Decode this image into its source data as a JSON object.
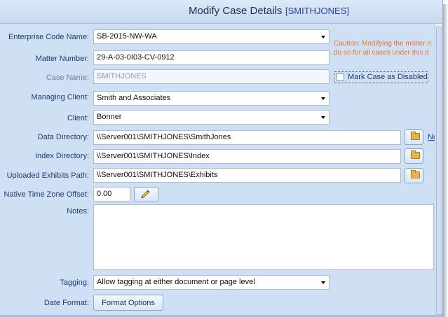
{
  "window": {
    "title": "Modify Case Details",
    "title_tag": "[SMITHJONES]"
  },
  "fields": {
    "enterprise_code": {
      "label": "Enterprise Code Name:",
      "value": "SB-2015-NW-WA"
    },
    "matter_number": {
      "label": "Matter Number:",
      "value": "29-A-03-0I03-CV-0912"
    },
    "case_name": {
      "label": "Case Name:",
      "value": "SMITHJONES"
    },
    "managing_client": {
      "label": "Managing Client:",
      "value": "Smith and Associates"
    },
    "client": {
      "label": "Client:",
      "value": "Bonner"
    },
    "data_directory": {
      "label": "Data Directory:",
      "value": "\\\\Server001\\SMITHJONES\\SmithJones"
    },
    "index_directory": {
      "label": "Index Directory:",
      "value": "\\\\Server001\\SMITHJONES\\Index"
    },
    "uploaded_exhibits_path": {
      "label": "Uploaded Exhibits Path:",
      "value": "\\\\Server001\\SMITHJONES\\Exhibits"
    },
    "native_time_zone_offset": {
      "label": "Native Time Zone Offset:",
      "value": "0.00"
    },
    "notes": {
      "label": "Notes:",
      "value": ""
    },
    "tagging": {
      "label": "Tagging:",
      "value": "Allow tagging at either document or page level"
    },
    "date_format": {
      "label": "Date Format:",
      "button_label": "Format Options"
    }
  },
  "caution": {
    "line1": "Caution: Modifying the matter n",
    "line2": "do so for all cases under this d"
  },
  "disable_checkbox": {
    "label": "Mark Case as Disabled",
    "checked": false
  },
  "data_directory_link": "No",
  "icons": {
    "browse": "folder-icon",
    "edit": "pencil-icon"
  },
  "colors": {
    "background": "#cfe0f5",
    "caution": "#e8732e",
    "label": "#1e3c6e",
    "link": "#1f3fb8"
  }
}
